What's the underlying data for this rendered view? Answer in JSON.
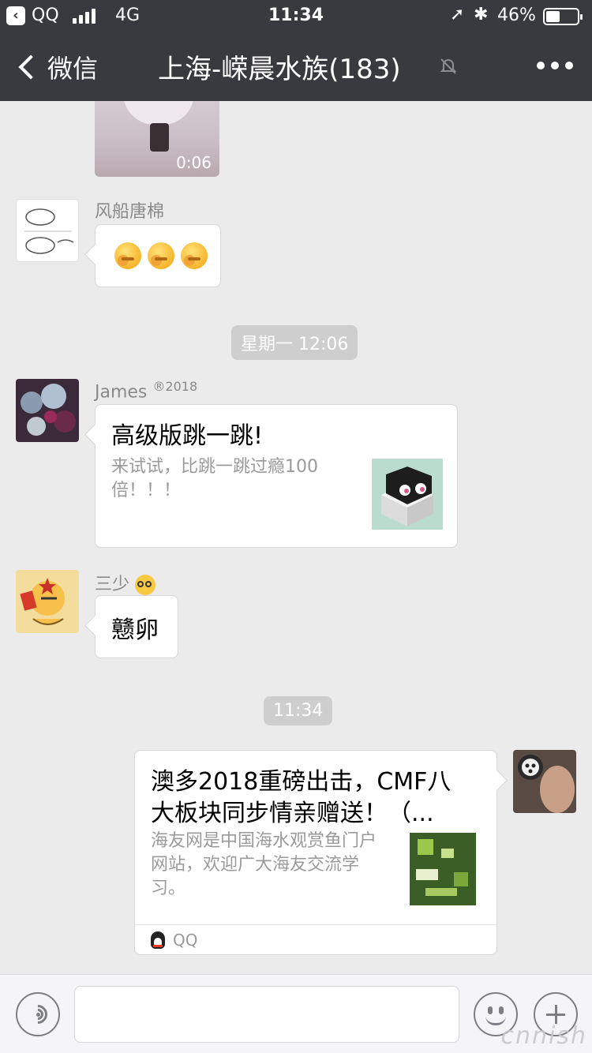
{
  "status_bar": {
    "back_app": "QQ",
    "network": "4G",
    "time": "11:34",
    "battery": "46%",
    "battery_level": 0.46
  },
  "nav": {
    "back_label": "微信",
    "title": "上海-嵘晨水族(183)"
  },
  "messages": {
    "video": {
      "duration": "0:06"
    },
    "msg1": {
      "sender": "风船唐棉",
      "emoji_count": 3
    },
    "time1": "星期一 12:06",
    "msg2": {
      "sender": "James",
      "sender_badge": "®2018",
      "title": "高级版跳一跳!",
      "desc": "来试试，比跳一跳过瘾100倍！！！"
    },
    "msg3": {
      "sender": "三少",
      "text": "戆卵"
    },
    "time2": "11:34",
    "msg4": {
      "title": "澳多2018重磅出击，CMF八大板块同步情亲赠送！（...",
      "desc": "海友网是中国海水观赏鱼门户网站，欢迎广大海友交流学习。",
      "source": "QQ"
    }
  },
  "input_bar": {
    "watermark": "cnnish"
  },
  "colors": {
    "nav_bg": "#393a3f",
    "chat_bg": "#ebebeb",
    "timestamp_bg": "#cecece"
  }
}
